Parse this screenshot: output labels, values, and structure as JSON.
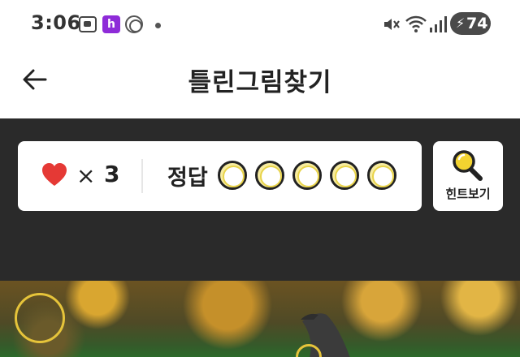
{
  "status_bar": {
    "time": "3:06",
    "app_h_label": "h",
    "battery_level": "74",
    "battery_charging": true,
    "icons": [
      "screenshot-icon",
      "app-h-icon",
      "app-circle-icon",
      "notification-dot",
      "mute-icon",
      "wifi-icon",
      "signal-icon",
      "battery-icon"
    ]
  },
  "header": {
    "title": "틀린그림찾기",
    "back_icon": "back-arrow-icon"
  },
  "game": {
    "lives_symbol": "×",
    "lives": "3",
    "answer_label": "정답",
    "answers_found": 0,
    "answers_total": 5,
    "hint_label": "힌트보기",
    "hint_icon": "magnifier-icon"
  },
  "colors": {
    "dark_panel": "#2a2a2a",
    "heart": "#e53935",
    "slot_yellow": "#e8d34a",
    "marker_yellow": "#e6c43a"
  }
}
